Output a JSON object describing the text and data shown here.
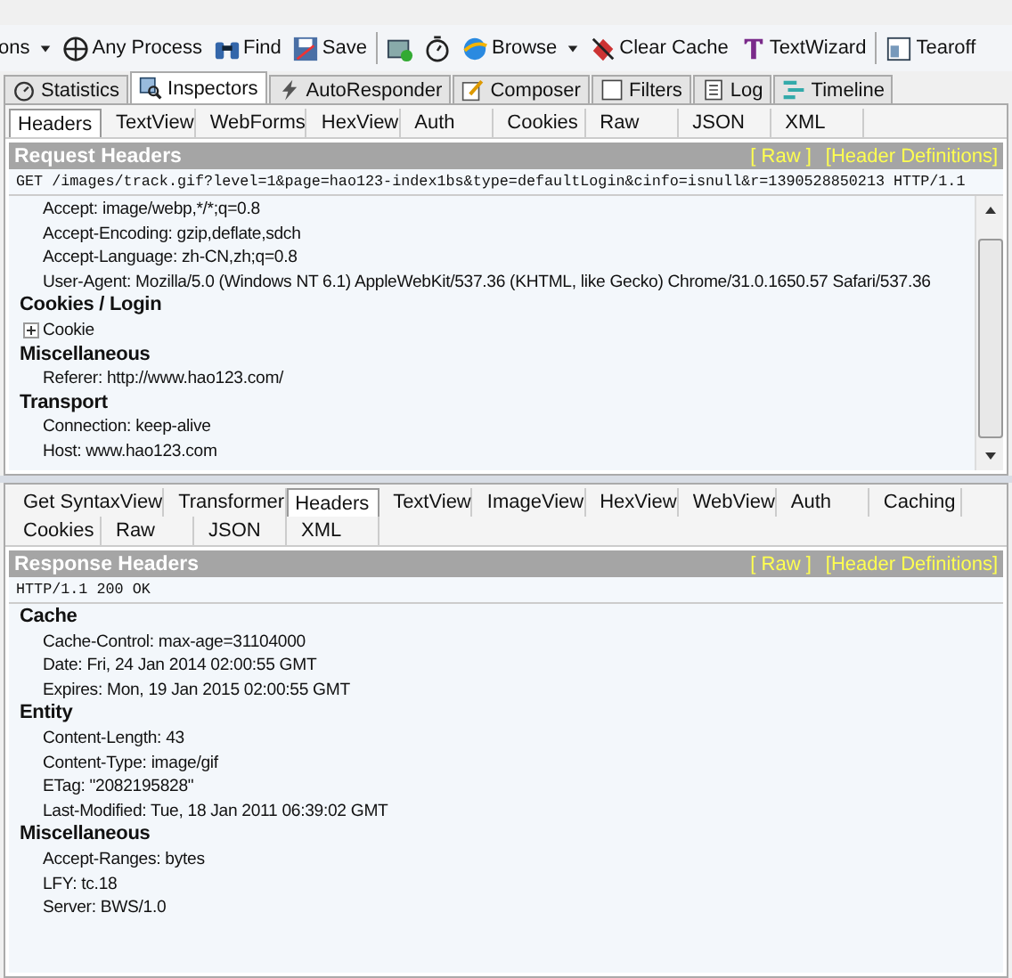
{
  "toolbar": {
    "items": [
      {
        "kind": "menu",
        "label": "ons",
        "dropdown": true
      },
      {
        "kind": "process",
        "label": "Any Process"
      },
      {
        "kind": "find",
        "label": "Find"
      },
      {
        "kind": "save",
        "label": "Save"
      },
      {
        "kind": "separator"
      },
      {
        "kind": "capture"
      },
      {
        "kind": "timer"
      },
      {
        "kind": "browse",
        "label": "Browse",
        "dropdown": true
      },
      {
        "kind": "clear",
        "label": "Clear Cache"
      },
      {
        "kind": "wizard",
        "label": "TextWizard"
      },
      {
        "kind": "separator"
      },
      {
        "kind": "tearoff",
        "label": "Tearoff"
      }
    ]
  },
  "main_tabs": [
    {
      "kind": "statistics",
      "label": "Statistics",
      "selected": false
    },
    {
      "kind": "inspectors",
      "label": "Inspectors",
      "selected": true
    },
    {
      "kind": "autoresponder",
      "label": "AutoResponder",
      "selected": false
    },
    {
      "kind": "composer",
      "label": "Composer",
      "selected": false
    },
    {
      "kind": "filters",
      "label": "Filters",
      "selected": false
    },
    {
      "kind": "log",
      "label": "Log",
      "selected": false
    },
    {
      "kind": "timeline",
      "label": "Timeline",
      "selected": false
    }
  ],
  "request": {
    "tabs": [
      {
        "label": "Headers",
        "selected": true
      },
      {
        "label": "TextView",
        "selected": false
      },
      {
        "label": "WebForms",
        "selected": false
      },
      {
        "label": "HexView",
        "selected": false
      },
      {
        "label": "Auth",
        "selected": false
      },
      {
        "label": "Cookies",
        "selected": false
      },
      {
        "label": "Raw",
        "selected": false
      },
      {
        "label": "JSON",
        "selected": false
      },
      {
        "label": "XML",
        "selected": false
      }
    ],
    "title": "Request Headers",
    "links": [
      "[ Raw ]",
      "[Header Definitions]"
    ],
    "first_line": "GET /images/track.gif?level=1&page=hao123-index1bs&type=defaultLogin&cinfo=isnull&r=1390528850213 HTTP/1.1",
    "tree": [
      {
        "children": [
          {
            "label": "Accept: image/webp,*/*;q=0.8"
          },
          {
            "label": "Accept-Encoding: gzip,deflate,sdch"
          },
          {
            "label": "Accept-Language: zh-CN,zh;q=0.8"
          },
          {
            "label": "User-Agent: Mozilla/5.0 (Windows NT 6.1) AppleWebKit/537.36 (KHTML, like Gecko) Chrome/31.0.1650.57 Safari/537.36"
          }
        ]
      },
      {
        "label": "Cookies / Login",
        "children": [
          {
            "label": "Cookie",
            "expanded": false
          }
        ]
      },
      {
        "label": "Miscellaneous",
        "children": [
          {
            "label": "Referer: http://www.hao123.com/"
          }
        ]
      },
      {
        "label": "Transport",
        "children": [
          {
            "label": "Connection: keep-alive"
          },
          {
            "label": "Host: www.hao123.com"
          }
        ]
      }
    ]
  },
  "response": {
    "tabs": [
      {
        "label": "Get SyntaxView",
        "selected": false
      },
      {
        "label": "Transformer",
        "selected": false
      },
      {
        "label": "Headers",
        "selected": true
      },
      {
        "label": "TextView",
        "selected": false
      },
      {
        "label": "ImageView",
        "selected": false
      },
      {
        "label": "HexView",
        "selected": false
      },
      {
        "label": "WebView",
        "selected": false
      },
      {
        "label": "Auth",
        "selected": false
      },
      {
        "label": "Caching",
        "selected": false
      },
      {
        "label": "Cookies",
        "selected": false
      },
      {
        "label": "Raw",
        "selected": false
      },
      {
        "label": "JSON",
        "selected": false
      },
      {
        "label": "XML",
        "selected": false
      }
    ],
    "title": "Response Headers",
    "links": [
      "[ Raw ]",
      "[Header Definitions]"
    ],
    "first_line": "HTTP/1.1 200 OK",
    "tree": [
      {
        "label": "Cache",
        "children": [
          {
            "label": "Cache-Control: max-age=31104000"
          },
          {
            "label": "Date: Fri, 24 Jan 2014 02:00:55 GMT"
          },
          {
            "label": "Expires: Mon, 19 Jan 2015 02:00:55 GMT"
          }
        ]
      },
      {
        "label": "Entity",
        "children": [
          {
            "label": "Content-Length: 43"
          },
          {
            "label": "Content-Type: image/gif"
          },
          {
            "label": "ETag: \"2082195828\""
          },
          {
            "label": "Last-Modified: Tue, 18 Jan 2011 06:39:02 GMT"
          }
        ]
      },
      {
        "label": "Miscellaneous",
        "children": [
          {
            "label": "Accept-Ranges: bytes"
          },
          {
            "label": "LFY: tc.18"
          },
          {
            "label": "Server: BWS/1.0"
          }
        ]
      }
    ]
  }
}
